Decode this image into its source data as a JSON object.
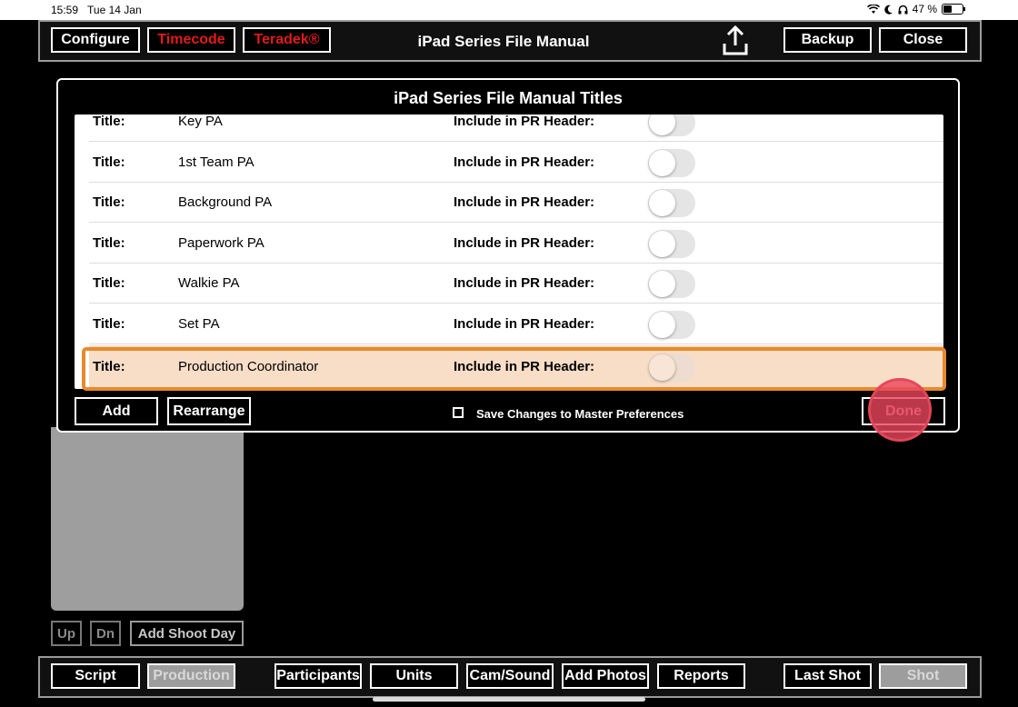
{
  "status": {
    "time": "15:59",
    "date": "Tue 14 Jan",
    "battery": "47 %",
    "battery_level": 0.47
  },
  "header": {
    "buttons": [
      "Configure",
      "Timecode",
      "Teradek®"
    ],
    "title": "iPad Series File Manual",
    "backup": "Backup",
    "close": "Close"
  },
  "dialog": {
    "title": "iPad Series File Manual Titles",
    "rows": [
      {
        "label": "Title:",
        "value": "Key PA",
        "include_label": "Include in PR Header:",
        "on": false
      },
      {
        "label": "Title:",
        "value": "1st Team PA",
        "include_label": "Include in PR Header:",
        "on": false
      },
      {
        "label": "Title:",
        "value": "Background PA",
        "include_label": "Include in PR Header:",
        "on": false
      },
      {
        "label": "Title:",
        "value": "Paperwork PA",
        "include_label": "Include in PR Header:",
        "on": false
      },
      {
        "label": "Title:",
        "value": "Walkie PA",
        "include_label": "Include in PR Header:",
        "on": false
      },
      {
        "label": "Title:",
        "value": "Set PA",
        "include_label": "Include in PR Header:",
        "on": false
      },
      {
        "label": "Title:",
        "value": "Production Coordinator",
        "include_label": "Include in PR Header:",
        "on": false
      }
    ],
    "add": "Add",
    "rearrange": "Rearrange",
    "save_label": "Save Changes to Master Preferences",
    "done": "Done"
  },
  "behind": {
    "up": "Up",
    "dn": "Dn",
    "add_shoot_day": "Add Shoot Day"
  },
  "footer": {
    "script": "Script",
    "production": "Production",
    "participants": "Participants",
    "units": "Units",
    "cam_sound": "Cam/Sound",
    "add_photos": "Add Photos",
    "reports": "Reports",
    "last_shot": "Last Shot",
    "shot": "Shot"
  }
}
